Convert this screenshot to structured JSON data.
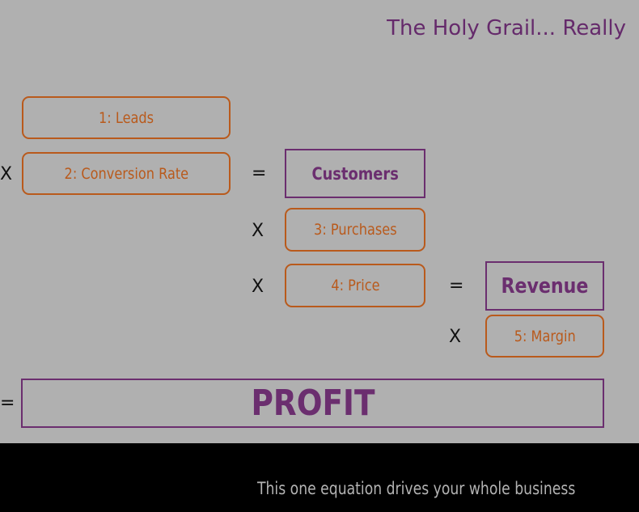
{
  "title": "The Holy Grail... Really",
  "factors": {
    "leads": "1: Leads",
    "conversion_rate": "2: Conversion Rate",
    "purchases": "3: Purchases",
    "price": "4: Price",
    "margin": "5: Margin"
  },
  "results": {
    "customers": "Customers",
    "revenue": "Revenue",
    "profit": "PROFIT"
  },
  "operators": {
    "multiply": "X",
    "equals": "="
  },
  "caption": "This one equation drives your whole business",
  "colors": {
    "factor": "#b95a1c",
    "result": "#6b2e6f",
    "background": "#b0b0b0",
    "footer": "#000000"
  }
}
